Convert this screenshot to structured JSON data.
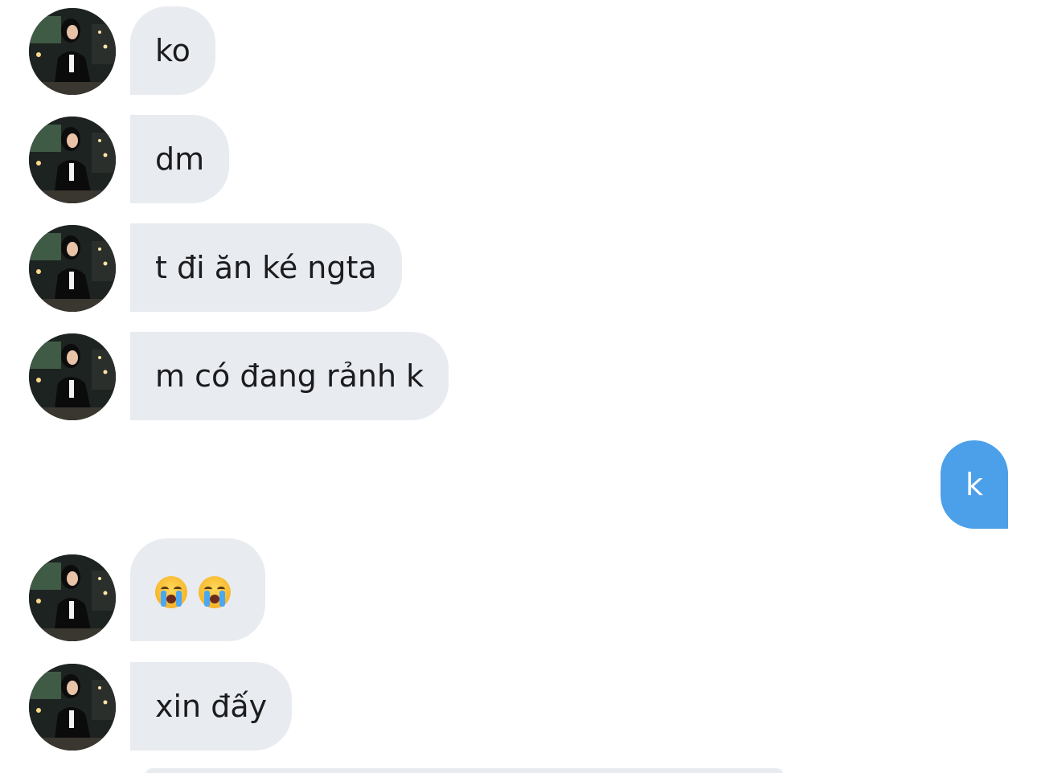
{
  "conversation": {
    "messages": [
      {
        "id": "m1",
        "direction": "incoming",
        "text": "ko"
      },
      {
        "id": "m2",
        "direction": "incoming",
        "text": "dm"
      },
      {
        "id": "m3",
        "direction": "incoming",
        "text": "t đi ăn ké ngta"
      },
      {
        "id": "m4",
        "direction": "incoming",
        "text": "m có đang rảnh k"
      },
      {
        "id": "m5",
        "direction": "outgoing",
        "text": "k"
      },
      {
        "id": "m6",
        "direction": "incoming",
        "text": "😭😭",
        "emoji": "loudly-crying-face"
      },
      {
        "id": "m7",
        "direction": "incoming",
        "text": "xin đấy"
      }
    ]
  },
  "colors": {
    "incoming_bubble": "#e8ebf0",
    "outgoing_bubble": "#4c9fe9",
    "incoming_text": "#1c1c1e",
    "outgoing_text": "#ffffff",
    "background": "#ffffff"
  },
  "icons": {
    "avatar": "contact-avatar-photo",
    "emoji": "loudly-crying-face"
  }
}
